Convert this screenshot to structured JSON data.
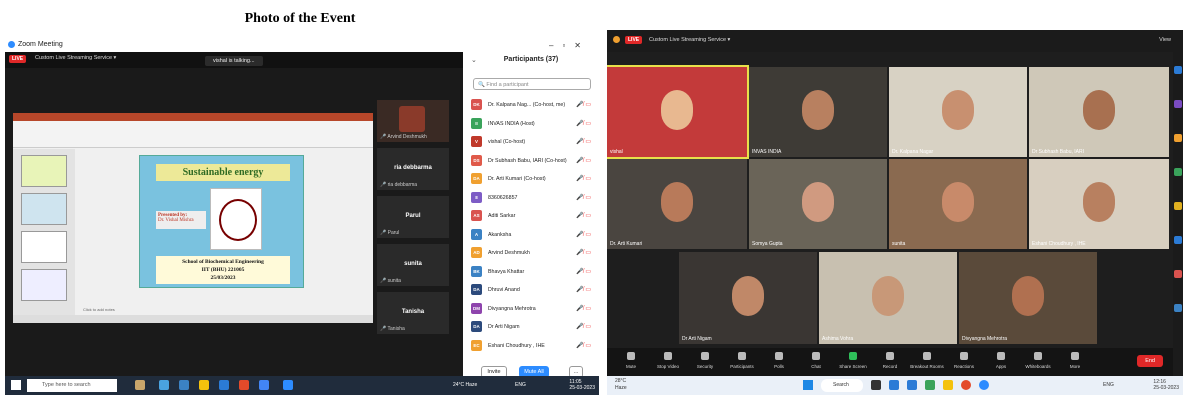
{
  "caption": "Photo of the Event",
  "left": {
    "window_title": "Zoom Meeting",
    "live_label": "LIVE",
    "stream_label": "Custom Live Streaming Service ▾",
    "talking": "vishal is talking...",
    "slide": {
      "title": "Sustainable energy",
      "presented_by": "Presented by:",
      "presenter": "Dr. Vishal Mishra",
      "school": "School of Biochemical Engineering",
      "institute": "IIT (BHU) 221005",
      "date": "25/03/2023"
    },
    "notes_placeholder": "Click to add notes",
    "tiles": [
      {
        "name": "",
        "sub": "Arvind Deshmukh"
      },
      {
        "name": "ria debbarma",
        "sub": "ria debbarma"
      },
      {
        "name": "Parul",
        "sub": "Parul"
      },
      {
        "name": "sunita",
        "sub": "sunita"
      },
      {
        "name": "Tanisha",
        "sub": "Tanisha"
      }
    ],
    "participants": {
      "title": "Participants (37)",
      "find_placeholder": "Find a participant",
      "list": [
        {
          "initials": "DK",
          "name": "Dr. Kalpana Nag... (Co-host, me)",
          "color": "#d9534f"
        },
        {
          "initials": "II",
          "name": "INVAS INDIA (Host)",
          "color": "#3aa35b"
        },
        {
          "initials": "V",
          "name": "vishal (Co-host)",
          "color": "#c0392b"
        },
        {
          "initials": "DS",
          "name": "Dr Subhash Babu, IARI (Co-host)",
          "color": "#e05a4a"
        },
        {
          "initials": "DA",
          "name": "Dr. Arti Kumari (Co-host)",
          "color": "#f0a030"
        },
        {
          "initials": "8",
          "name": "8360626857",
          "color": "#7d5cc6"
        },
        {
          "initials": "AS",
          "name": "Aditi Sarkar",
          "color": "#d9534f"
        },
        {
          "initials": "A",
          "name": "Akanksha",
          "color": "#3b82c4"
        },
        {
          "initials": "AD",
          "name": "Arvind Deshmukh",
          "color": "#f0a030"
        },
        {
          "initials": "BK",
          "name": "Bhavya Khattar",
          "color": "#3b82c4"
        },
        {
          "initials": "DA",
          "name": "Dhruvi Anand",
          "color": "#2c4a7c"
        },
        {
          "initials": "DM",
          "name": "Divyangna Mehrotra",
          "color": "#8e44ad"
        },
        {
          "initials": "DA",
          "name": "Dr Arti Nigam",
          "color": "#2c4a7c"
        },
        {
          "initials": "EC",
          "name": "Eshani Choudhury , IHE",
          "color": "#f0a030"
        }
      ],
      "invite": "Invite",
      "mute_all": "Mute All",
      "more": "..."
    },
    "taskbar": {
      "search": "Type here to search",
      "weather": "24°C Haze",
      "lang": "ENG",
      "time": "11:05",
      "date": "25-03-2023"
    }
  },
  "right": {
    "live_label": "LIVE",
    "stream_label": "Custom Live Streaming Service ▾",
    "view_label": "View",
    "videos": [
      {
        "name": "vishal"
      },
      {
        "name": "INVAS INDIA"
      },
      {
        "name": "Dr. Kalpana Nagar"
      },
      {
        "name": "Dr Subhash Babu, IARI"
      },
      {
        "name": "Dr. Arti Kumari"
      },
      {
        "name": "Somya Gupta"
      },
      {
        "name": "sunita"
      },
      {
        "name": "Eshani Choudhury , IHE"
      },
      {
        "name": "Dr Arti Nigam"
      },
      {
        "name": "Ashima Vohra"
      },
      {
        "name": "Divyangna Mehrotra"
      }
    ],
    "controls": [
      "Mute",
      "Stop Video",
      "Security",
      "Participants",
      "Polls",
      "Chat",
      "Share Screen",
      "Record",
      "Breakout Rooms",
      "Reactions",
      "Apps",
      "Whiteboards",
      "More"
    ],
    "end_label": "End",
    "taskbar": {
      "temp": "28°C",
      "weather": "Haze",
      "search": "Search",
      "lang": "ENG",
      "time": "12:16",
      "date": "25-03-2023"
    }
  }
}
